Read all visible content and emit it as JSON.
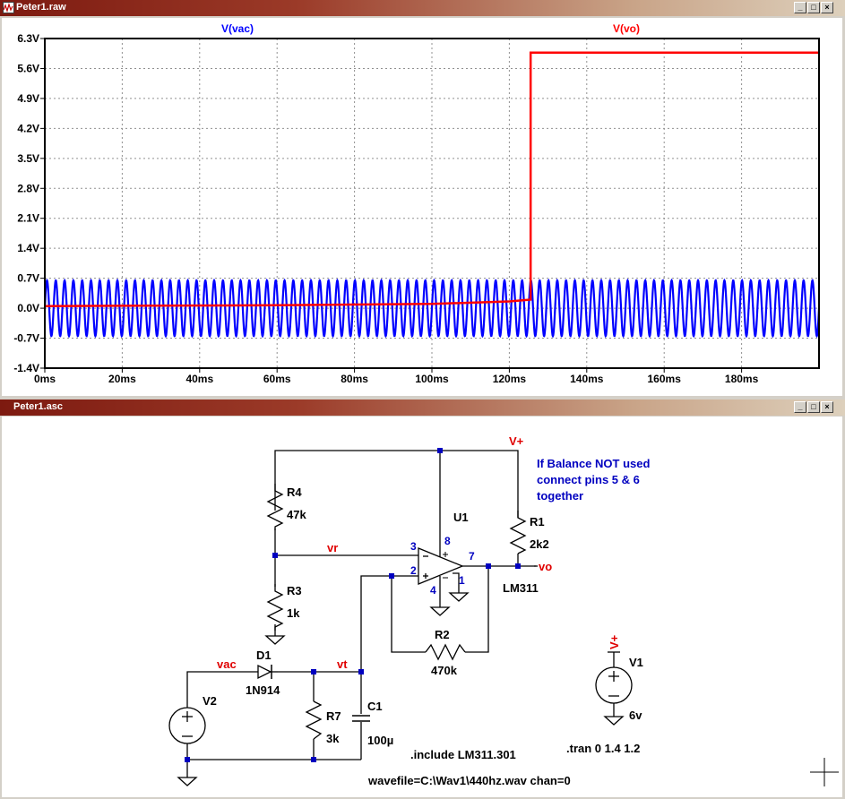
{
  "waveform_window": {
    "title": "Peter1.raw",
    "buttons": {
      "minimize": "_",
      "restore": "□",
      "close": "×"
    }
  },
  "schematic_window": {
    "title": "Peter1.asc",
    "buttons": {
      "minimize": "_",
      "restore": "□",
      "close": "×"
    }
  },
  "colors": {
    "trace_vac": "#0000ff",
    "trace_vo": "#ff0000",
    "wire": "#000000",
    "net_label": "#ff0000",
    "pin_label": "#0000c0",
    "comment": "#0000c0",
    "title_active": "#7d1a10"
  },
  "chart_data": {
    "type": "line",
    "series": [
      {
        "name": "V(vac)",
        "kind": "sine",
        "amplitude_v": 0.65,
        "offset_v": 0.0,
        "frequency_hz": 440,
        "x_range_ms": [
          0,
          200
        ]
      },
      {
        "name": "V(vo)",
        "kind": "step",
        "points_ms_v": [
          [
            0,
            0.05
          ],
          [
            60,
            0.07
          ],
          [
            100,
            0.1
          ],
          [
            120,
            0.16
          ],
          [
            125.5,
            0.2
          ],
          [
            125.5,
            5.97
          ],
          [
            200,
            5.97
          ]
        ]
      }
    ],
    "y_ticks": [
      "6.3V",
      "5.6V",
      "4.9V",
      "4.2V",
      "3.5V",
      "2.8V",
      "2.1V",
      "1.4V",
      "0.7V",
      "0.0V",
      "-0.7V",
      "-1.4V"
    ],
    "y_tick_values": [
      6.3,
      5.6,
      4.9,
      4.2,
      3.5,
      2.8,
      2.1,
      1.4,
      0.7,
      0.0,
      -0.7,
      -1.4
    ],
    "x_ticks": [
      "0ms",
      "20ms",
      "40ms",
      "60ms",
      "80ms",
      "100ms",
      "120ms",
      "140ms",
      "160ms",
      "180ms"
    ],
    "x_tick_values": [
      0,
      20,
      40,
      60,
      80,
      100,
      120,
      140,
      160,
      180
    ],
    "xlim_ms": [
      0,
      200
    ],
    "ylim_v": [
      -1.4,
      6.3
    ],
    "grid": true,
    "legend_placement": "top"
  },
  "schematic": {
    "components": {
      "R4": {
        "name": "R4",
        "value": "47k"
      },
      "R3": {
        "name": "R3",
        "value": "1k"
      },
      "R1": {
        "name": "R1",
        "value": "2k2"
      },
      "R2": {
        "name": "R2",
        "value": "470k"
      },
      "R7": {
        "name": "R7",
        "value": "3k"
      },
      "C1": {
        "name": "C1",
        "value": "100µ"
      },
      "D1": {
        "name": "D1",
        "value": "1N914"
      },
      "U1": {
        "name": "U1",
        "value": "LM311"
      },
      "V1": {
        "name": "V1",
        "value": "6v"
      },
      "V2": {
        "name": "V2"
      }
    },
    "nets": {
      "vplus": "V+",
      "vr": "vr",
      "vac": "vac",
      "vt": "vt",
      "vo": "vo",
      "v1_flag": "V+"
    },
    "pins": {
      "p3": "3",
      "p2": "2",
      "p8": "8",
      "p7": "7",
      "p4": "4",
      "p1": "1"
    },
    "comment_lines": [
      "If Balance NOT used",
      "connect pins 5 & 6",
      "together"
    ],
    "directives": {
      "include": ".include LM311.301",
      "tran": ".tran 0 1.4 1.2",
      "wavefile": "wavefile=C:\\Wav1\\440hz.wav chan=0"
    }
  }
}
